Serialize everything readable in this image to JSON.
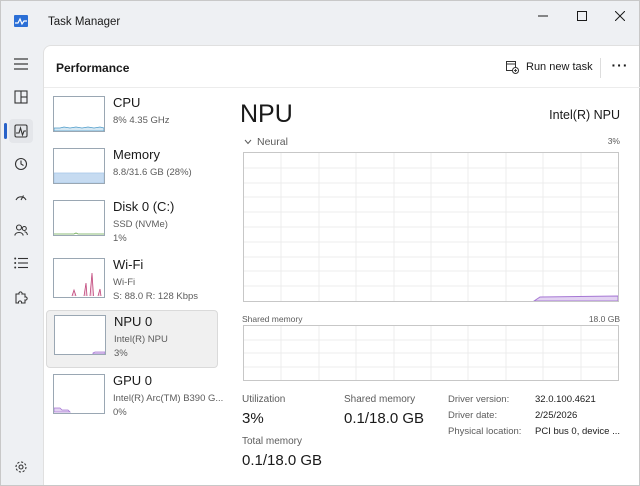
{
  "window": {
    "title": "Task Manager"
  },
  "header": {
    "title": "Performance",
    "run_new_task": "Run new task",
    "more_label": "···"
  },
  "devices": [
    {
      "name": "CPU",
      "line1": "8%  4.35 GHz",
      "line2": ""
    },
    {
      "name": "Memory",
      "line1": "8.8/31.6 GB (28%)",
      "line2": ""
    },
    {
      "name": "Disk 0 (C:)",
      "line1": "SSD (NVMe)",
      "line2": "1%"
    },
    {
      "name": "Wi-Fi",
      "line1": "Wi-Fi",
      "line2": "S: 88.0  R: 128 Kbps"
    },
    {
      "name": "NPU 0",
      "line1": "Intel(R) NPU",
      "line2": "3%"
    },
    {
      "name": "GPU 0",
      "line1": "Intel(R) Arc(TM) B390 G...",
      "line2": "0%"
    }
  ],
  "selected_device_index": 4,
  "detail": {
    "title": "NPU",
    "model": "Intel(R) NPU",
    "graph_label": "Neural",
    "graph_max": "3%",
    "shared_memory_label": "Shared memory",
    "shared_memory_max": "18.0 GB",
    "utilization_label": "Utilization",
    "utilization_value": "3%",
    "shared_memory_stat_label": "Shared memory",
    "shared_memory_stat_value": "0.1/18.0 GB",
    "total_memory_label": "Total memory",
    "total_memory_value": "0.1/18.0 GB",
    "driver_version_label": "Driver version:",
    "driver_version_value": "32.0.100.4621",
    "driver_date_label": "Driver date:",
    "driver_date_value": "2/25/2026",
    "physical_location_label": "Physical location:",
    "physical_location_value": "PCI bus 0, device ..."
  },
  "colors": {
    "accent": "#2862c8",
    "cpu_graph": "#4d9bc9",
    "memory_graph": "#a9c8ea",
    "disk_graph": "#6aa84f",
    "wifi_graph": "#c0457a",
    "npu_graph": "#a678d4",
    "gpu_graph": "#a678d4"
  }
}
